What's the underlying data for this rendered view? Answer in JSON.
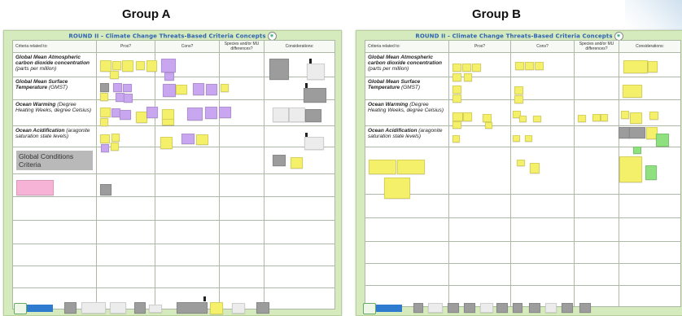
{
  "groups": [
    {
      "title": "Group A"
    },
    {
      "title": "Group B"
    }
  ],
  "board_title": "ROUND II - Climate Change Threats-Based Criteria Concepts",
  "columns": [
    "Criteria related to:",
    "Pros?",
    "Cons?",
    "Species and/or MU differences?",
    "Considerations:"
  ],
  "criteria": [
    {
      "name": "Global Mean Atmospheric carbon dioxide concentration",
      "detail": "(parts per million)"
    },
    {
      "name": "Global Mean Surface Temperature",
      "detail": "(GMST)"
    },
    {
      "name": "Ocean Warming",
      "detail": "(Degree Heating Weeks, degree Celsius)"
    },
    {
      "name": "Ocean Acidification",
      "detail": "(aragonite saturation state levels)"
    }
  ],
  "global_conditions": "Global Conditions Criteria",
  "colors": {
    "board": "#d6ebbd",
    "title": "#2f63b0",
    "yellow_note": "#f4f06a",
    "purple_note": "#c9a6f0",
    "gray_note": "#9c9c9c",
    "pink_note": "#f6b3d6",
    "green_note": "#8fe07e"
  }
}
